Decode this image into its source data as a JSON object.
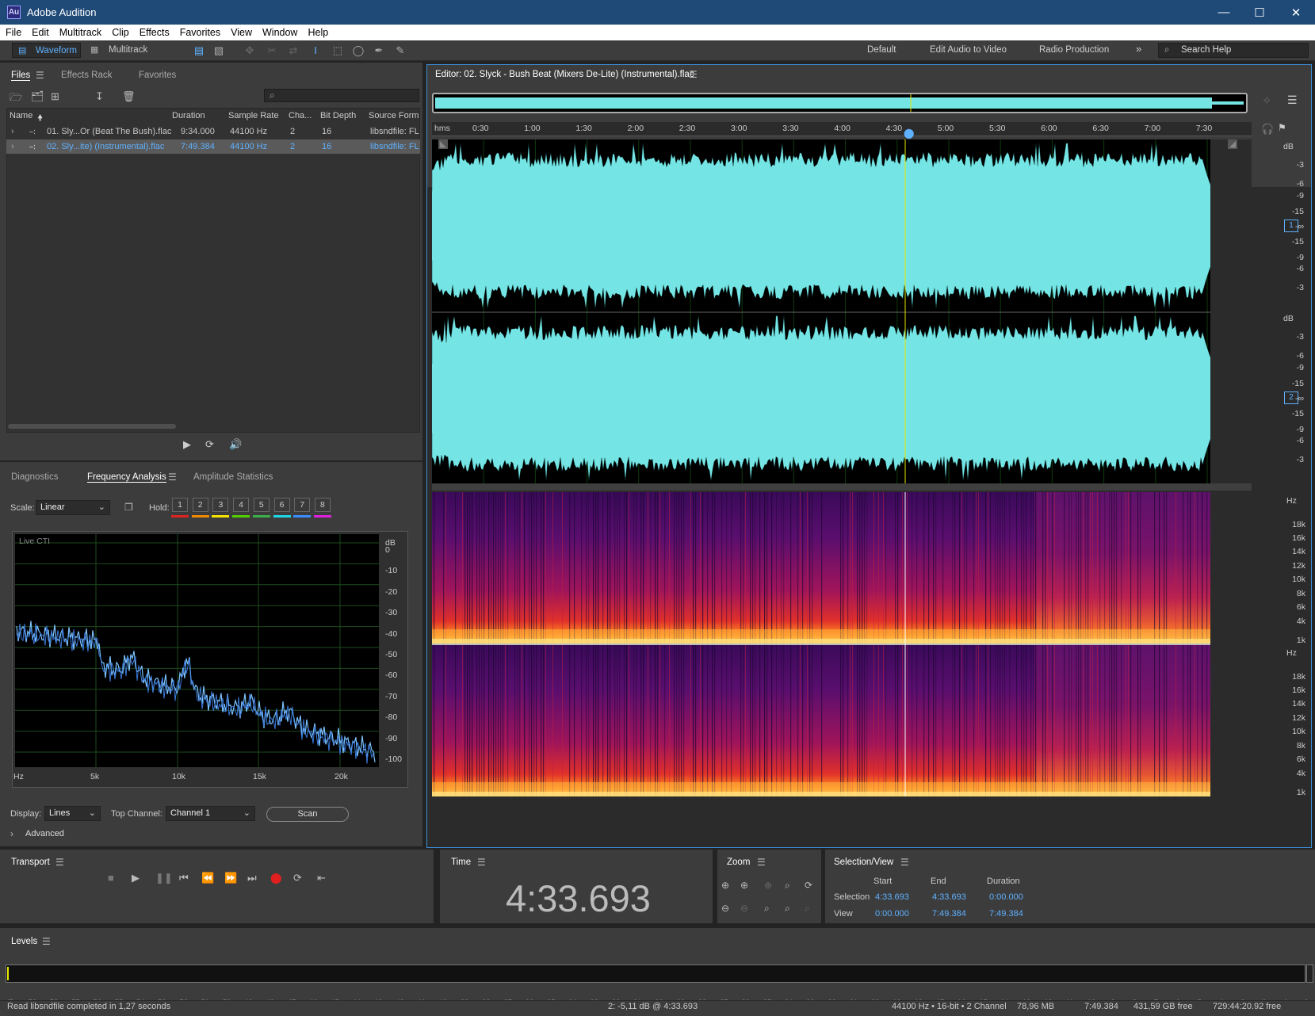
{
  "window": {
    "title": "Adobe Audition",
    "logo": "Au"
  },
  "menu": [
    "File",
    "Edit",
    "Multitrack",
    "Clip",
    "Effects",
    "Favorites",
    "View",
    "Window",
    "Help"
  ],
  "toolbar": {
    "waveform_label": "Waveform",
    "multitrack_label": "Multitrack",
    "workspaces": [
      "Default",
      "Edit Audio to Video",
      "Radio Production"
    ],
    "search_label": "Search Help"
  },
  "files_panel": {
    "tabs": [
      "Files",
      "Effects Rack",
      "Favorites"
    ],
    "columns": [
      "Name",
      "Duration",
      "Sample Rate",
      "Cha...",
      "Bit Depth",
      "Source Form..."
    ],
    "files": [
      {
        "name": "01. Sly...Or (Beat The Bush).flac",
        "duration": "9:34.000",
        "rate": "44100 Hz",
        "ch": "2",
        "bits": "16",
        "source": "libsndfile: FL"
      },
      {
        "name": "02. Sly...ite) (Instrumental).flac",
        "duration": "7:49.384",
        "rate": "44100 Hz",
        "ch": "2",
        "bits": "16",
        "source": "libsndfile: FL"
      }
    ]
  },
  "analysis_panel": {
    "tabs": [
      "Diagnostics",
      "Frequency Analysis",
      "Amplitude Statistics"
    ],
    "scale_label": "Scale:",
    "scale_value": "Linear",
    "hold_label": "Hold:",
    "hold": [
      "1",
      "2",
      "3",
      "4",
      "5",
      "6",
      "7",
      "8"
    ],
    "hold_colors": [
      "#e0231e",
      "#f08a00",
      "#f5e400",
      "#54d000",
      "#3ab04a",
      "#1ed8e8",
      "#3a8cff",
      "#e020e0"
    ],
    "graph_label": "Live CTI",
    "db_ticks": [
      "dB",
      "0",
      "-10",
      "-20",
      "-30",
      "-40",
      "-50",
      "-60",
      "-70",
      "-80",
      "-90",
      "-100"
    ],
    "hz_ticks": [
      "Hz",
      "5k",
      "10k",
      "15k",
      "20k"
    ],
    "display_label": "Display:",
    "display_value": "Lines",
    "top_channel_label": "Top Channel:",
    "top_channel_value": "Channel 1",
    "scan_label": "Scan",
    "advanced_label": "Advanced"
  },
  "editor": {
    "title": "Editor: 02. Slyck - Bush Beat (Mixers De-Lite) (Instrumental).flac",
    "ruler": [
      "hms",
      "0:30",
      "1:00",
      "1:30",
      "2:00",
      "2:30",
      "3:00",
      "3:30",
      "4:00",
      "4:30",
      "5:00",
      "5:30",
      "6:00",
      "6:30",
      "7:00",
      "7:30"
    ],
    "db_scale": [
      "dB",
      "-3",
      "-6",
      "-9",
      "-15",
      "-∞",
      "-15",
      "-9",
      "-6",
      "-3"
    ],
    "channels": [
      "1",
      "2"
    ],
    "hz_scale": [
      "Hz",
      "18k",
      "16k",
      "14k",
      "12k",
      "10k",
      "8k",
      "6k",
      "4k",
      "1k"
    ],
    "waveform_color": "#74e4e4"
  },
  "transport": {
    "title": "Transport"
  },
  "time": {
    "title": "Time",
    "value": "4:33.693"
  },
  "zoom": {
    "title": "Zoom"
  },
  "selection_view": {
    "title": "Selection/View",
    "headers": [
      "Start",
      "End",
      "Duration"
    ],
    "rows": [
      {
        "label": "Selection",
        "start": "4:33.693",
        "end": "4:33.693",
        "duration": "0:00.000"
      },
      {
        "label": "View",
        "start": "0:00.000",
        "end": "7:49.384",
        "duration": "7:49.384"
      }
    ]
  },
  "levels": {
    "title": "Levels",
    "ticks": [
      "dB",
      "-59",
      "-58",
      "-57",
      "-56",
      "-55",
      "-54",
      "-53",
      "-52",
      "-51",
      "-50",
      "-49",
      "-48",
      "-47",
      "-46",
      "-45",
      "-44",
      "-43",
      "-42",
      "-41",
      "-40",
      "-39",
      "-38",
      "-37",
      "-36",
      "-35",
      "-34",
      "-33",
      "-32",
      "-31",
      "-30",
      "-29",
      "-28",
      "-27",
      "-26",
      "-25",
      "-24",
      "-23",
      "-22",
      "-21",
      "-20",
      "-19",
      "-18",
      "-17",
      "-16",
      "-15",
      "-14",
      "-13",
      "-12",
      "-11",
      "-10",
      "-9",
      "-8",
      "-7",
      "-6",
      "-5",
      "-4",
      "-3",
      "-2",
      "-1",
      "0"
    ]
  },
  "status": {
    "message": "Read libsndfile completed in 1,27 seconds",
    "cursor": "2: -5,11 dB @ 4:33.693",
    "format": "44100 Hz • 16-bit • 2 Channel",
    "size": "78,96 MB",
    "duration": "7:49.384",
    "free": "431,59 GB free",
    "free_time": "729:44:20.92 free"
  }
}
